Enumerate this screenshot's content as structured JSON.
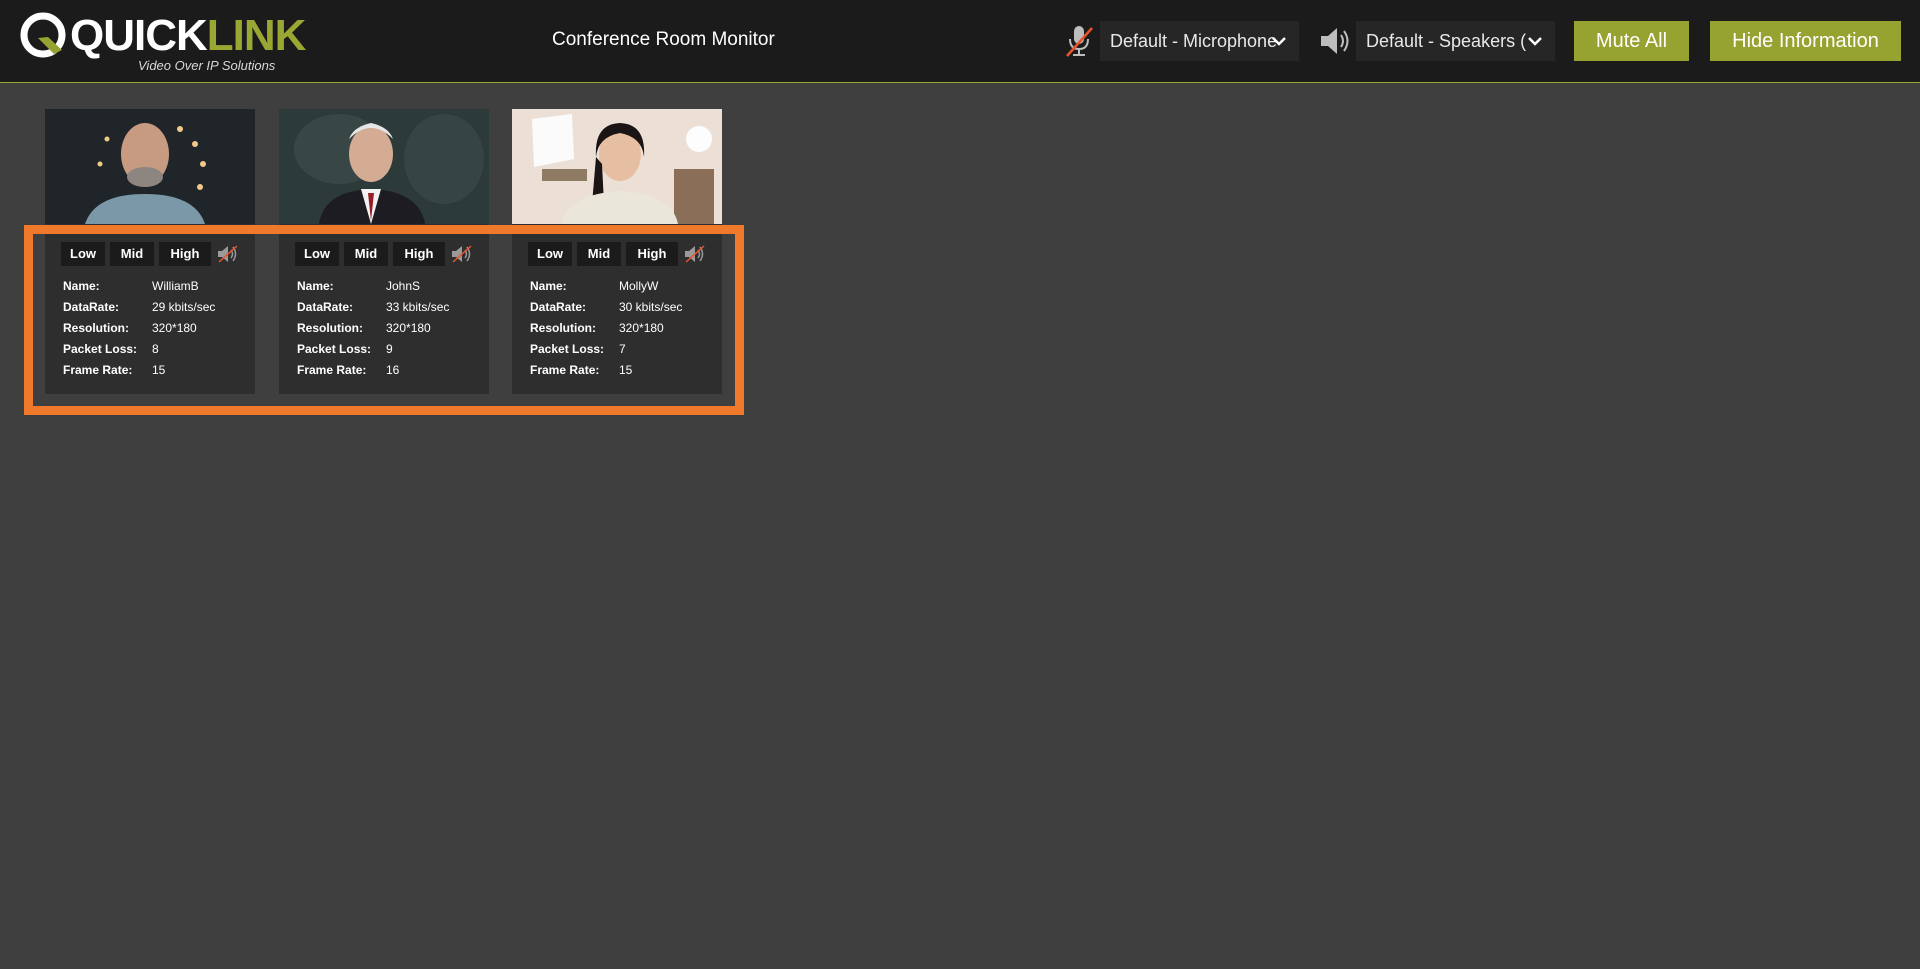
{
  "brand": {
    "logo_text_white": "QUICK",
    "logo_text_green": "LINK",
    "tagline": "Video Over IP Solutions",
    "accent_color": "#96a330"
  },
  "header": {
    "title": "Conference Room Monitor",
    "mic_icon": "microphone-muted-icon",
    "mic_select_value": "Default - Microphone",
    "speaker_icon": "speaker-icon",
    "speaker_select_value": "Default - Speakers (",
    "mute_all_label": "Mute All",
    "hide_info_label": "Hide Information"
  },
  "highlight_color": "#ef7a2b",
  "labels": {
    "low": "Low",
    "mid": "Mid",
    "high": "High",
    "name": "Name:",
    "data_rate": "DataRate:",
    "resolution": "Resolution:",
    "packet_loss": "Packet Loss:",
    "frame_rate": "Frame Rate:"
  },
  "participants": [
    {
      "name": "WilliamB",
      "data_rate": "29 kbits/sec",
      "resolution": "320*180",
      "packet_loss": "8",
      "frame_rate": "15"
    },
    {
      "name": "JohnS",
      "data_rate": "33 kbits/sec",
      "resolution": "320*180",
      "packet_loss": "9",
      "frame_rate": "16"
    },
    {
      "name": "MollyW",
      "data_rate": "30 kbits/sec",
      "resolution": "320*180",
      "packet_loss": "7",
      "frame_rate": "15"
    }
  ]
}
